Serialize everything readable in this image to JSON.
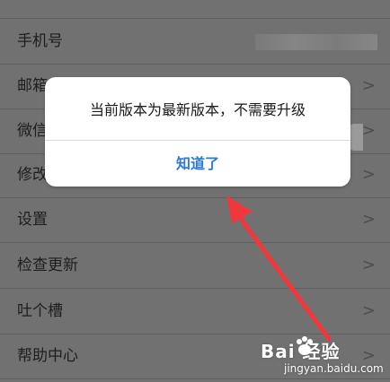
{
  "settings": {
    "rows": [
      {
        "label": "手机号",
        "show_chevron": false,
        "masked_value": true
      },
      {
        "label": "邮箱",
        "show_chevron": true
      },
      {
        "label": "微信",
        "show_chevron": true
      },
      {
        "label": "修改",
        "show_chevron": true
      },
      {
        "label": "设置",
        "show_chevron": true
      },
      {
        "label": "检查更新",
        "show_chevron": true
      },
      {
        "label": "吐个槽",
        "show_chevron": true
      },
      {
        "label": "帮助中心",
        "show_chevron": true
      }
    ],
    "chevron_glyph": ">"
  },
  "dialog": {
    "message": "当前版本为最新版本，不需要升级",
    "ok_label": "知道了",
    "ok_color": "#2b7bd6"
  },
  "annotation": {
    "arrow_color": "#f0383c"
  },
  "watermark": {
    "brand": "Bai 经验",
    "url": "jingyan.baidu.com"
  }
}
